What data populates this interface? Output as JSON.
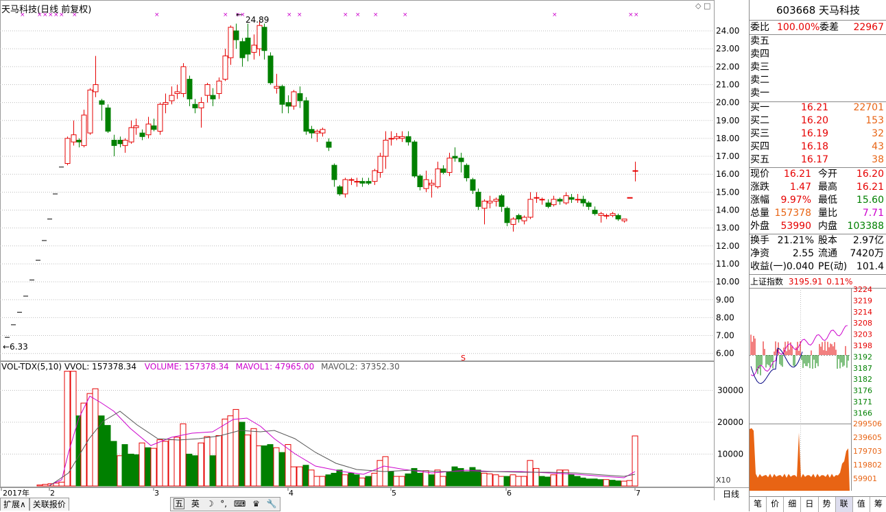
{
  "header": {
    "title": "天马科技(日线 前复权)",
    "peak_label": "24.89",
    "low_label": "6.33",
    "peak_arrow": "←",
    "low_arrow": "←6.33"
  },
  "price_axis": {
    "labels": [
      "24.00",
      "23.00",
      "22.00",
      "21.00",
      "20.00",
      "19.00",
      "18.00",
      "17.00",
      "16.00",
      "15.00",
      "14.00",
      "13.00",
      "12.00",
      "11.00",
      "10.00",
      "9.00",
      "8.00",
      "7.00",
      "6.00"
    ]
  },
  "volume_axis": {
    "labels": [
      "30000",
      "20000",
      "10000"
    ],
    "unit_label": "X10"
  },
  "volume_header": {
    "name": "VOL-TDX(5,10)",
    "vvol": "VVOL: 157378.34",
    "volume": "VOLUME: 157378.34",
    "mavol1": "MAVOL1: 47965.00",
    "mavol2": "MAVOL2: 37352.30"
  },
  "date_axis": {
    "labels": [
      "2017年",
      "2",
      "3",
      "4",
      "5",
      "6",
      "7"
    ],
    "period": "日线"
  },
  "bottom_tabs": {
    "expand": "扩展∧",
    "related": "关联报价"
  },
  "taskbar": {
    "items": [
      "五",
      "英",
      "☽",
      "°,",
      "⌨",
      "♛",
      "🔧"
    ]
  },
  "quote": {
    "code_name": "603668 天马科技",
    "weibi_label": "委比",
    "weibi": "100.00%",
    "weicha_label": "委差",
    "weicha": "22967",
    "sell": [
      {
        "label": "卖五",
        "price": "",
        "vol": ""
      },
      {
        "label": "卖四",
        "price": "",
        "vol": ""
      },
      {
        "label": "卖三",
        "price": "",
        "vol": ""
      },
      {
        "label": "卖二",
        "price": "",
        "vol": ""
      },
      {
        "label": "卖一",
        "price": "",
        "vol": ""
      }
    ],
    "buy": [
      {
        "label": "买一",
        "price": "16.21",
        "vol": "22701"
      },
      {
        "label": "买二",
        "price": "16.20",
        "vol": "153"
      },
      {
        "label": "买三",
        "price": "16.19",
        "vol": "32"
      },
      {
        "label": "买四",
        "price": "16.18",
        "vol": "43"
      },
      {
        "label": "买五",
        "price": "16.17",
        "vol": "38"
      }
    ],
    "stats": [
      {
        "l1": "现价",
        "v1": "16.21",
        "l2": "今开",
        "v2": "16.20"
      },
      {
        "l1": "涨跌",
        "v1": "1.47",
        "l2": "最高",
        "v2": "16.21"
      },
      {
        "l1": "涨幅",
        "v1": "9.97%",
        "l2": "最低",
        "v2": "15.60"
      },
      {
        "l1": "总量",
        "v1": "157378",
        "l2": "量比",
        "v2": "7.71"
      },
      {
        "l1": "外盘",
        "v1": "53990",
        "l2": "内盘",
        "v2": "103388"
      }
    ],
    "fund": [
      {
        "l1": "换手",
        "v1": "21.21%",
        "l2": "股本",
        "v2": "2.97亿"
      },
      {
        "l1": "净资",
        "v1": "2.55",
        "l2": "流通",
        "v2": "7420万"
      },
      {
        "l1": "收益(一)",
        "v1": "0.040",
        "l2": "PE(动)",
        "v2": "101.4"
      }
    ]
  },
  "index_chart": {
    "name": "上证指数",
    "value": "3195.91",
    "change": "0.11%",
    "price_labels": [
      "3224",
      "3219",
      "3214",
      "3208",
      "3203",
      "3198",
      "3192",
      "3187",
      "3182",
      "3176",
      "3171",
      "3166"
    ],
    "vol_labels": [
      "299506",
      "239605",
      "179703",
      "119802",
      "59901"
    ]
  },
  "side_tabs": [
    "笔",
    "价",
    "细",
    "日",
    "势",
    "联",
    "值",
    "筹"
  ],
  "colors": {
    "up": "#e60000",
    "down": "#008000",
    "ma1": "#cc00cc",
    "ma2": "#555555",
    "axis_text": "#000000",
    "red_text": "#e60000",
    "green_text": "#008000"
  }
}
